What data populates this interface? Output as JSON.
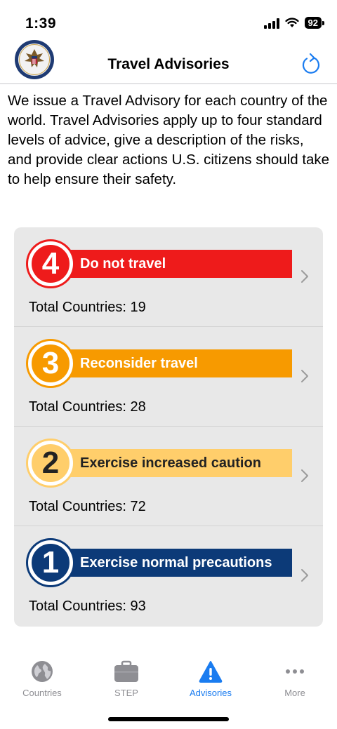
{
  "status": {
    "time": "1:39",
    "battery": "92"
  },
  "nav": {
    "title": "Travel Advisories"
  },
  "intro": {
    "text": "We issue a Travel Advisory for each country of the world. Travel Advisories apply up to four standard levels of advice, give a description of the risks, and provide clear actions U.S. citizens should take to help ensure their safety."
  },
  "advisories": [
    {
      "level": "4",
      "label": "Do not travel",
      "count": "Total Countries: 19",
      "bar_color": "#ee1b1b",
      "text_color": "#ffffff"
    },
    {
      "level": "3",
      "label": "Reconsider travel",
      "count": "Total Countries: 28",
      "bar_color": "#f79a00",
      "text_color": "#ffffff"
    },
    {
      "level": "2",
      "label": "Exercise increased caution",
      "count": "Total Countries: 72",
      "bar_color": "#ffce6b",
      "text_color": "#222222"
    },
    {
      "level": "1",
      "label": "Exercise normal precautions",
      "count": "Total Countries: 93",
      "bar_color": "#0c3a78",
      "text_color": "#ffffff"
    }
  ],
  "tabs": [
    {
      "label": "Countries",
      "icon": "globe-icon"
    },
    {
      "label": "STEP",
      "icon": "briefcase-icon"
    },
    {
      "label": "Advisories",
      "icon": "warning-icon"
    },
    {
      "label": "More",
      "icon": "ellipsis-icon"
    }
  ],
  "colors": {
    "accent": "#1a7cf0",
    "card_bg": "#e8e8e8",
    "inactive": "#8e8e93"
  }
}
